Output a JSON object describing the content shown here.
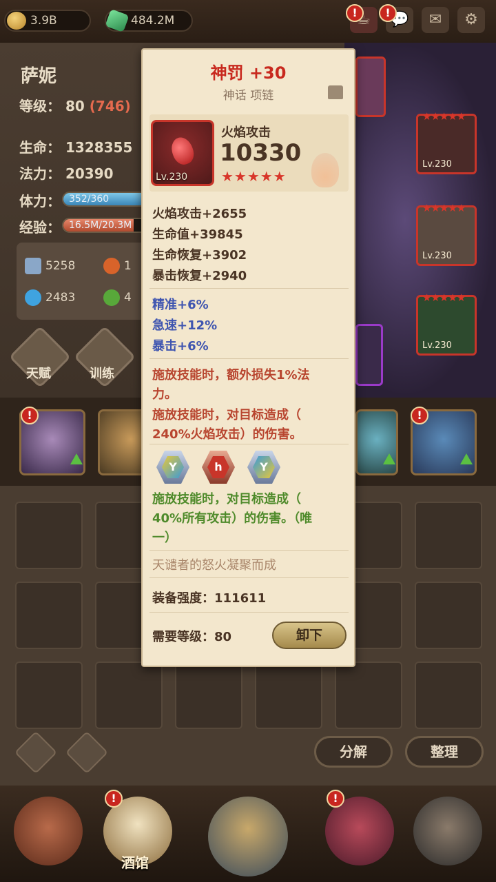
{
  "topbar": {
    "gold": "3.9B",
    "gems": "484.2M"
  },
  "hero": {
    "name": "萨妮",
    "level_label": "等级：",
    "level": "80",
    "level_extra": "(746)",
    "hp_label": "生命：",
    "hp": "1328355",
    "mp_label": "法力：",
    "mp": "20390",
    "stamina_label": "体力：",
    "stamina": "352/360",
    "stamina_fraction": 0.98,
    "exp_label": "经验：",
    "exp": "16.5M/20.3M",
    "exp_fraction": 0.81,
    "stats": [
      {
        "icon": "sword-icon",
        "value": "5258"
      },
      {
        "icon": "fire-icon",
        "value": "1"
      },
      {
        "icon": "ice-icon",
        "value": "2483"
      },
      {
        "icon": "leaf-icon",
        "value": "4"
      }
    ],
    "buttons": {
      "talent": "天赋",
      "train": "训练"
    },
    "equipment_levels": [
      "Lv.230",
      "Lv.230",
      "Lv.230"
    ]
  },
  "tooltip": {
    "title": "神罚 +30",
    "subtitle": "神话 项链",
    "item_level": "Lv.230",
    "main_stat_label": "火焰攻击",
    "main_stat_value": "10330",
    "stars": "★★★★★",
    "base_stats": [
      "火焰攻击+2655",
      "生命值+39845",
      "生命恢复+3902",
      "暴击恢复+2940"
    ],
    "bonus_stats": [
      "精准+6%",
      "急速+12%",
      "暴击+6%"
    ],
    "effects": [
      "施放技能时，额外损失1%法",
      "力。",
      "施放技能时，对目标造成（",
      "240%火焰攻击）的伤害。"
    ],
    "sockets": [
      {
        "icon": "rune-y-icon",
        "glyph": "Y"
      },
      {
        "icon": "rune-h-icon",
        "glyph": "h"
      },
      {
        "icon": "rune-y-icon",
        "glyph": "Y"
      }
    ],
    "set_effect": [
      "施放技能时，对目标造成（",
      "40%所有攻击）的伤害。（唯",
      "一）"
    ],
    "lore": "天谴者的怒火凝聚而成",
    "power_label": "装备强度：",
    "power_value": "111611",
    "req_label": "需要等级：",
    "req_value": "80",
    "unequip_label": "卸下"
  },
  "inventory": {
    "decompose": "分解",
    "sort": "整理"
  },
  "bottomnav": {
    "tavern": "酒馆"
  },
  "colors": {
    "title_red": "#c8291e",
    "bonus_blue": "#3f55b0",
    "effect_red": "#b8452f",
    "set_green": "#4e8a2a",
    "parchment": "#f3e7cd"
  }
}
